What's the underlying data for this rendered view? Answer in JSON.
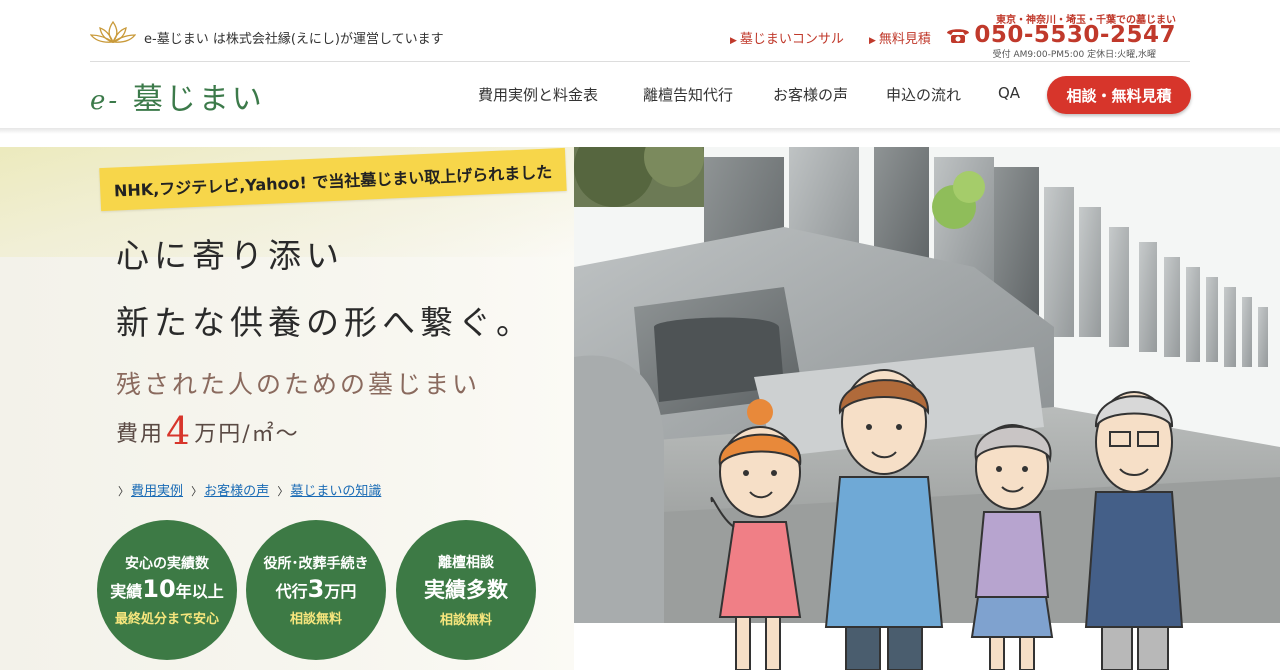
{
  "header": {
    "operator_text": "e-墓じまい は株式会社縁(えにし)が運営しています",
    "links": [
      {
        "label": "墓じまいコンサル"
      },
      {
        "label": "無料見積"
      }
    ],
    "area_note": "東京・神奈川・埼玉・千葉での墓じまい",
    "phone": "050-5530-2547",
    "hours": "受付 AM9:00-PM5:00  定休日:火曜,水曜",
    "logo_prefix": "e-",
    "logo_text": "墓じまい"
  },
  "nav": {
    "items": [
      {
        "label": "費用実例と料金表"
      },
      {
        "label": "離檀告知代行"
      },
      {
        "label": "お客様の声"
      },
      {
        "label": "申込の流れ"
      },
      {
        "label": "QA"
      }
    ],
    "cta_label": "相談・無料見積"
  },
  "hero": {
    "badge": "NHK,フジテレビ,Yahoo! で当社墓じまい取上げられました",
    "catch_line1": "心に寄り添い",
    "catch_line2": "新たな供養の形へ繋ぐ。",
    "sub": "残された人のための墓じまい",
    "price_prefix": "費用",
    "price_num": "4",
    "price_suffix": "万円/㎡〜",
    "links": [
      {
        "label": "費用実例"
      },
      {
        "label": "お客様の声"
      },
      {
        "label": "墓じまいの知識"
      }
    ],
    "circles": [
      {
        "line1": "安心の実績数",
        "line2_pre": "実績",
        "line2_big": "10",
        "line2_post": "年以上",
        "line3": "最終処分まで安心"
      },
      {
        "line1": "役所･改葬手続き",
        "line2_pre": "代行",
        "line2_big": "3",
        "line2_post": "万円",
        "line3": "相談無料"
      },
      {
        "line1": "離檀相談",
        "line2_pre": "",
        "line2_big": "実績多数",
        "line2_post": "",
        "line3": "相談無料"
      }
    ]
  },
  "colors": {
    "brand_green": "#3d7a45",
    "accent_red": "#d7352b",
    "badge_yellow": "#f7d64a",
    "link_blue": "#1a6bb5"
  }
}
